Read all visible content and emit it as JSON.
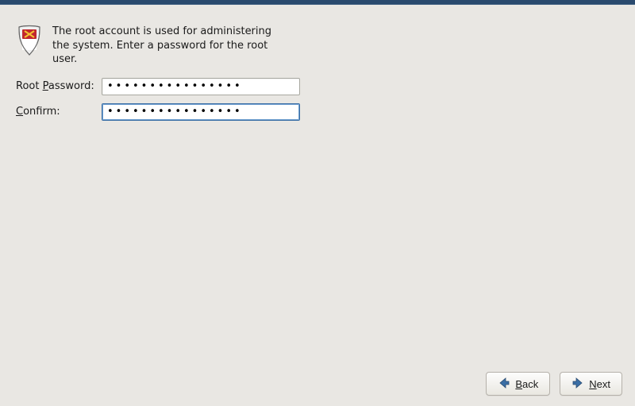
{
  "intro": {
    "icon": "shield-icon",
    "text": "The root account is used for administering the system.  Enter a password for the root user."
  },
  "form": {
    "root_password": {
      "label_pre": "Root ",
      "label_ul": "P",
      "label_post": "assword:",
      "value": "••••••••••••••••"
    },
    "confirm": {
      "label_pre": "",
      "label_ul": "C",
      "label_post": "onfirm:",
      "value": "••••••••••••••••"
    }
  },
  "buttons": {
    "back": {
      "icon": "arrow-left-icon",
      "ul": "B",
      "rest": "ack"
    },
    "next": {
      "icon": "arrow-right-icon",
      "ul": "N",
      "rest": "ext"
    }
  }
}
